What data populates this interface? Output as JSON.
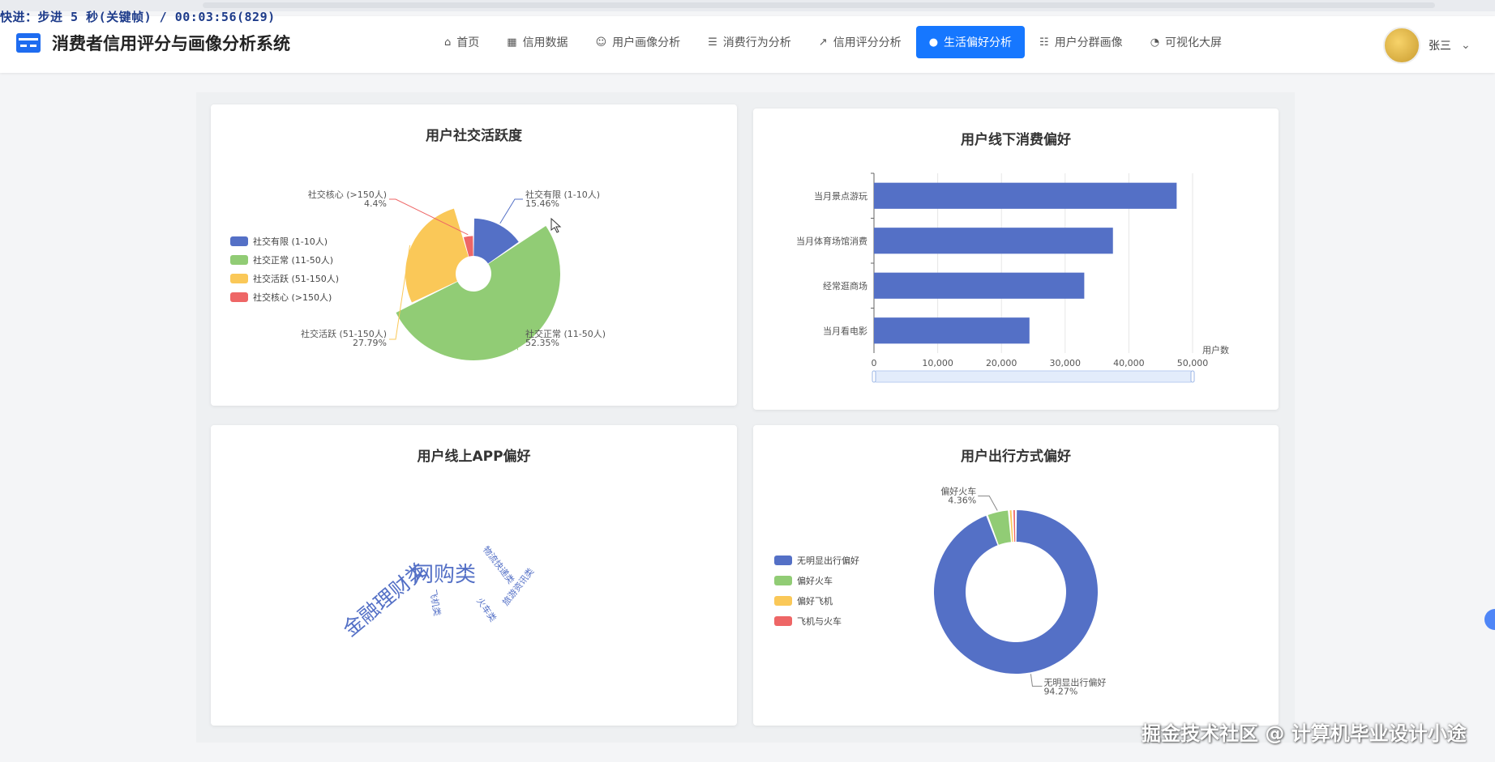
{
  "overlay_caption": "快进：步进 5 秒(关键帧) / 00:03:56(829)",
  "header": {
    "title": "消费者信用评分与画像分析系统",
    "nav": [
      {
        "label": "首页",
        "icon": "⌂"
      },
      {
        "label": "信用数据",
        "icon": "▦"
      },
      {
        "label": "用户画像分析",
        "icon": "☺"
      },
      {
        "label": "消费行为分析",
        "icon": "☰"
      },
      {
        "label": "信用评分分析",
        "icon": "↗"
      },
      {
        "label": "生活偏好分析",
        "icon": "●"
      },
      {
        "label": "用户分群画像",
        "icon": "☷"
      },
      {
        "label": "可视化大屏",
        "icon": "◔"
      }
    ],
    "active_index": 5,
    "user_name": "张三",
    "accent": "#1677ff"
  },
  "watermark": "掘金技术社区 @ 计算机毕业设计小途",
  "chart_data": [
    {
      "id": "social",
      "type": "pie",
      "subtype": "rose",
      "title": "用户社交活跃度",
      "categories": [
        "社交有限 (1-10人)",
        "社交正常 (11-50人)",
        "社交活跃 (51-150人)",
        "社交核心 (>150人)"
      ],
      "values": [
        15.46,
        52.35,
        27.79,
        4.4
      ],
      "labels": [
        "15.46%",
        "52.35%",
        "27.79%",
        "4.4%"
      ],
      "colors": [
        "#5470c6",
        "#91cc75",
        "#fac858",
        "#ee6666"
      ],
      "legend_position": "left"
    },
    {
      "id": "offline",
      "type": "bar",
      "orientation": "horizontal",
      "title": "用户线下消费偏好",
      "categories": [
        "当月景点游玩",
        "当月体育场馆消费",
        "经常逛商场",
        "当月看电影"
      ],
      "values": [
        47500,
        37500,
        33000,
        24400
      ],
      "xlabel": "用户数",
      "xlim": [
        0,
        50000
      ],
      "ticks": [
        "0",
        "10,000",
        "20,000",
        "30,000",
        "40,000",
        "50,000"
      ],
      "color": "#5470c6",
      "grid": true
    },
    {
      "id": "app",
      "type": "wordcloud",
      "title": "用户线上APP偏好",
      "words": [
        "金融理财类",
        "网购类",
        "物流快递类",
        "旅游资讯类",
        "火车类",
        "飞机类"
      ],
      "color": "#5470c6"
    },
    {
      "id": "travel",
      "type": "pie",
      "subtype": "donut",
      "title": "用户出行方式偏好",
      "categories": [
        "无明显出行偏好",
        "偏好火车",
        "偏好飞机",
        "飞机与火车"
      ],
      "values": [
        94.27,
        4.36,
        0.7,
        0.67
      ],
      "labels": [
        "94.27%",
        "4.36%"
      ],
      "colors": [
        "#5470c6",
        "#91cc75",
        "#fac858",
        "#ee6666"
      ],
      "legend_position": "left"
    }
  ]
}
